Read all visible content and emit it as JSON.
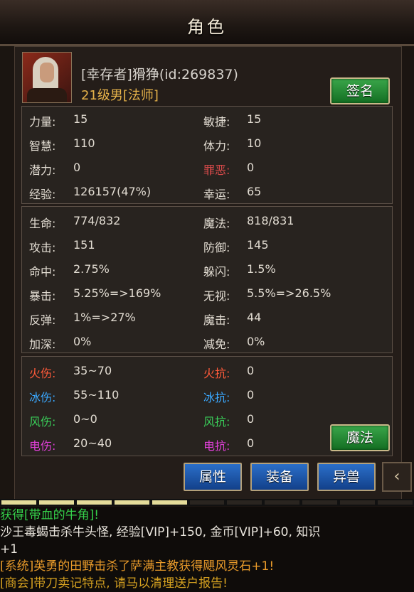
{
  "title": "角色",
  "profile": {
    "name": "[幸存者]猾狰(id:269837)",
    "level": "21级男[法师]",
    "sign_label": "签名"
  },
  "stats1": [
    {
      "label": "力量:",
      "value": "15",
      "label2": "敏捷:",
      "value2": "15"
    },
    {
      "label": "智慧:",
      "value": "110",
      "label2": "体力:",
      "value2": "10"
    },
    {
      "label": "潜力:",
      "value": "0",
      "label2": "罪恶:",
      "value2": "0"
    },
    {
      "label": "经验:",
      "value": "126157(47%)",
      "label2": "幸运:",
      "value2": "65"
    }
  ],
  "stats2": [
    {
      "label": "生命:",
      "value": "774/832",
      "label2": "魔法:",
      "value2": "818/831"
    },
    {
      "label": "攻击:",
      "value": "151",
      "label2": "防御:",
      "value2": "145"
    },
    {
      "label": "命中:",
      "value": "2.75%",
      "label2": "躲闪:",
      "value2": "1.5%"
    },
    {
      "label": "暴击:",
      "value": "5.25%=>169%",
      "label2": "无视:",
      "value2": "5.5%=>26.5%"
    },
    {
      "label": "反弹:",
      "value": "1%=>27%",
      "label2": "魔击:",
      "value2": "44"
    },
    {
      "label": "加深:",
      "value": "0%",
      "label2": "减免:",
      "value2": "0%"
    }
  ],
  "stats3": [
    {
      "label": "火伤:",
      "value": "35~70",
      "label2": "火抗:",
      "value2": "0"
    },
    {
      "label": "冰伤:",
      "value": "55~110",
      "label2": "冰抗:",
      "value2": "0"
    },
    {
      "label": "风伤:",
      "value": "0~0",
      "label2": "风抗:",
      "value2": "0"
    },
    {
      "label": "电伤:",
      "value": "20~40",
      "label2": "电抗:",
      "value2": "0"
    }
  ],
  "magic_label": "魔法",
  "tabs": {
    "attr": "属性",
    "equip": "装备",
    "beast": "异兽"
  },
  "back_icon": "‹",
  "progress": {
    "filled_segments": 5,
    "total_segments": 11
  },
  "log": [
    {
      "text": "获得[带血的牛角]!",
      "color": "#35d04a"
    },
    {
      "text": "沙王毒蝎击杀牛头怪, 经验[VIP]+150, 金币[VIP]+60, 知识",
      "color": "#e8e4dc"
    },
    {
      "text": "+1",
      "color": "#e8e4dc"
    },
    {
      "text": "[系统]英勇的田野击杀了萨满主教获得飓风灵石+1!",
      "color": "#e89a2a"
    },
    {
      "text": "[商会]带刀卖记特点, 请马以清理送户报告!",
      "color": "#d4a020"
    }
  ],
  "colors": {
    "fire": "#ff5a3a",
    "ice": "#3aa8ff",
    "wind": "#3ad05a",
    "elec": "#e040d8",
    "sin": "#d84a4a"
  }
}
